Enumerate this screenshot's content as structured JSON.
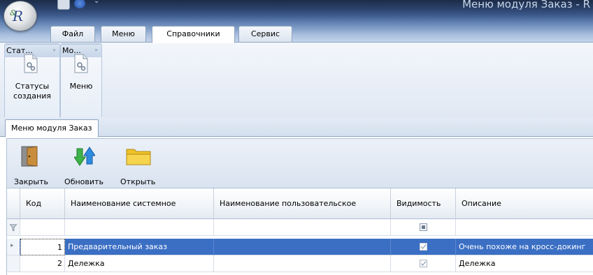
{
  "window": {
    "title": "Меню модуля Заказ - R"
  },
  "ribbon": {
    "tabs": [
      {
        "label": "Файл"
      },
      {
        "label": "Меню"
      },
      {
        "label": "Справочники"
      },
      {
        "label": "Сервис"
      }
    ],
    "active_tab": "Справочники",
    "groups": [
      {
        "button_label_1": "Статусы",
        "button_label_2": "создания",
        "group_label": "Стат..."
      },
      {
        "button_label_1": "Меню",
        "group_label": "Мо..."
      }
    ]
  },
  "document_tab": {
    "label": "Меню модуля Заказ"
  },
  "toolbar": {
    "close_label": "Закрыть",
    "refresh_label": "Обновить",
    "open_label": "Открыть"
  },
  "grid": {
    "columns": [
      "Код",
      "Наименование системное",
      "Наименование пользовательское",
      "Видимость",
      "Описание"
    ],
    "rows": [
      {
        "code": "1",
        "system_name": "Предварительный заказ",
        "user_name": "",
        "visible": true,
        "description": "Очень похоже на кросс-докинг"
      },
      {
        "code": "2",
        "system_name": "Дележка",
        "user_name": "",
        "visible": true,
        "description": "Дележка"
      }
    ]
  },
  "colors": {
    "selection": "#3b6fc4",
    "title_bar": "#2a416a",
    "ribbon": "#dbe4f0"
  }
}
